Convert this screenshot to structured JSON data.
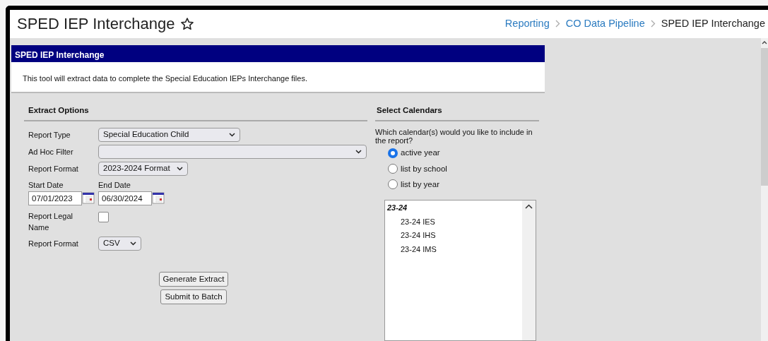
{
  "page": {
    "title": "SPED IEP Interchange",
    "favorite": false
  },
  "breadcrumb": [
    {
      "label": "Reporting",
      "link": true
    },
    {
      "label": "CO Data Pipeline",
      "link": true
    },
    {
      "label": "SPED IEP Interchange",
      "link": false
    }
  ],
  "panel": {
    "title": "SPED IEP Interchange",
    "description": "This tool will extract data to complete the Special Education IEPs Interchange files."
  },
  "extract_options": {
    "heading": "Extract Options",
    "fields": [
      {
        "kind": "select",
        "label": "Report Type",
        "value": "Special Education Child"
      },
      {
        "kind": "select",
        "label": "Ad Hoc Filter"
      },
      {
        "kind": "select",
        "label": "Report Format",
        "value": "2023-2024 Format"
      },
      {
        "kind": "dates",
        "dates": [
          {
            "label": "Start Date",
            "value": "07/01/2023"
          },
          {
            "label": "End Date",
            "value": "06/30/2024"
          }
        ]
      },
      {
        "kind": "checkbox",
        "label": "Report Legal Name",
        "checked": false
      },
      {
        "kind": "select",
        "label": "Report Format",
        "value": "CSV"
      }
    ],
    "buttons": [
      "Generate Extract",
      "Submit to Batch"
    ]
  },
  "select_calendars": {
    "heading": "Select Calendars",
    "question": "Which calendar(s) would you like to include in the report?",
    "options": [
      {
        "label": "active year",
        "selected": true
      },
      {
        "label": "list by school",
        "selected": false
      },
      {
        "label": "list by year",
        "selected": false
      }
    ],
    "calendars": [
      {
        "label": "23-24",
        "children": [
          {
            "label": "23-24 IES"
          },
          {
            "label": "23-24 IHS"
          },
          {
            "label": "23-24 IMS"
          }
        ]
      }
    ]
  }
}
